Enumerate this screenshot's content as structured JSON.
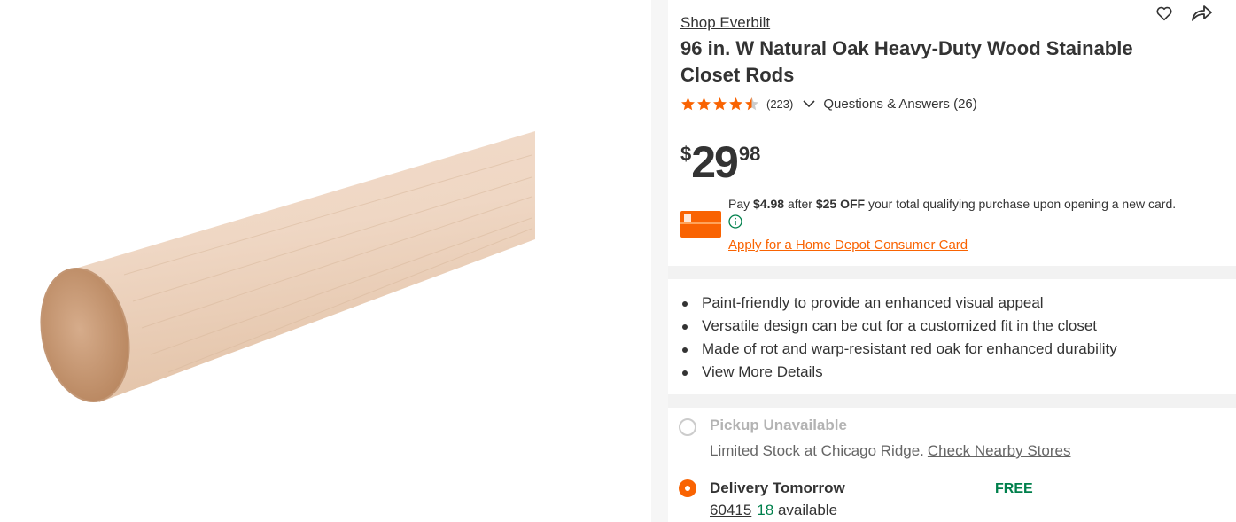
{
  "colors": {
    "brand_orange": "#f96302",
    "success_green": "#00804c",
    "text": "#333333",
    "muted": "#b3b3b3"
  },
  "media": {
    "alt": "Wood closet rod image"
  },
  "header_icons": {
    "favorite": "heart-icon",
    "share": "share-icon"
  },
  "product": {
    "brand_link": "Shop Everbilt",
    "title": "96 in. W Natural Oak Heavy-Duty Wood Stainable Closet Rods",
    "rating": {
      "value": 4.5,
      "max": 5,
      "review_count": "(223)"
    },
    "qa_link": "Questions & Answers (26)"
  },
  "price": {
    "currency": "$",
    "dollars": "29",
    "cents": "98"
  },
  "promo": {
    "pre": "Pay ",
    "amount": "$4.98",
    "mid": " after ",
    "discount": "$25 OFF",
    "post": " your total qualifying purchase upon opening a new card.",
    "apply_link": "Apply for a Home Depot Consumer Card"
  },
  "bullets": [
    "Paint-friendly to provide an enhanced visual appeal",
    "Versatile design can be cut for a customized fit in the closet",
    "Made of rot and warp-resistant red oak for enhanced durability"
  ],
  "view_more": "View More Details",
  "fulfillment": {
    "pickup": {
      "title": "Pickup Unavailable",
      "subtitle": "Limited Stock at Chicago Ridge.",
      "link": "Check Nearby Stores"
    },
    "delivery": {
      "title": "Delivery Tomorrow",
      "price": "FREE",
      "zip": "60415",
      "count": "18",
      "available_label": "available"
    }
  }
}
